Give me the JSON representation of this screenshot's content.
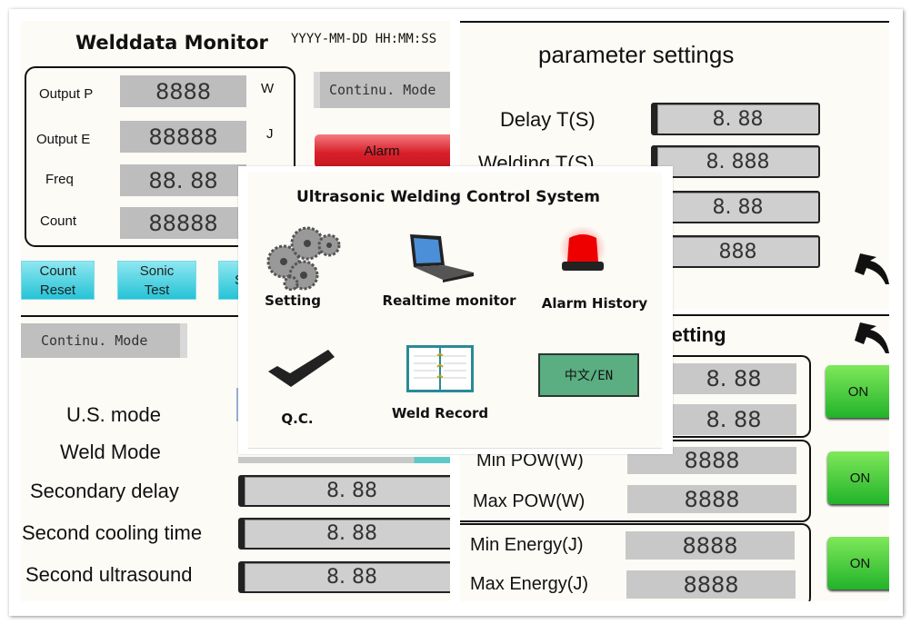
{
  "monitor": {
    "title": "Welddata Monitor",
    "datetime": "YYYY-MM-DD HH:MM:SS",
    "rows": [
      {
        "label": "Output P",
        "value": "8888",
        "unit": "W"
      },
      {
        "label": "Output E",
        "value": "88888",
        "unit": "J"
      },
      {
        "label": "Freq",
        "value": "88. 88"
      },
      {
        "label": "Count",
        "value": "88888"
      }
    ],
    "mode": "Continu. Mode",
    "alarm": "Alarm",
    "buttons": [
      "Count Reset",
      "Sonic Test",
      "S"
    ]
  },
  "params": {
    "title": "parameter settings",
    "rows": [
      {
        "label": "Delay T(S)",
        "value": "8. 88"
      },
      {
        "label": "Welding T(S)",
        "value": "8. 888"
      },
      {
        "value": "8. 88"
      },
      {
        "value": "888"
      }
    ]
  },
  "secondary": {
    "mode": "Continu. Mode",
    "labels": [
      "U.S. mode",
      "Weld Mode"
    ],
    "rows": [
      {
        "label": "Secondary delay",
        "value": "8. 88"
      },
      {
        "label": "Second cooling time",
        "value": "8. 88"
      },
      {
        "label": "Second ultrasound",
        "value": "8. 88"
      }
    ]
  },
  "qc": {
    "title": "Setting",
    "rows": [
      {
        "value": "8. 88"
      },
      {
        "value": "8. 88"
      },
      {
        "label": "Min POW(W)",
        "value": "8888"
      },
      {
        "label": "Max POW(W)",
        "value": "8888"
      },
      {
        "label": "Min Energy(J)",
        "value": "8888"
      },
      {
        "label": "Max Energy(J)",
        "value": "8888"
      }
    ],
    "toggle": "ON"
  },
  "menu": {
    "title": "Ultrasonic Welding Control System",
    "items": [
      "Setting",
      "Realtime monitor",
      "Alarm History",
      "Q.C.",
      "Weld Record"
    ],
    "language": "中文/EN"
  },
  "colors": {
    "panel": "#fdfbf6",
    "value_box": "#c8c8c8",
    "alarm": "#e0303a",
    "cyan": "#25c3d6",
    "on": "#3fc93a",
    "language": "#5aae82"
  }
}
